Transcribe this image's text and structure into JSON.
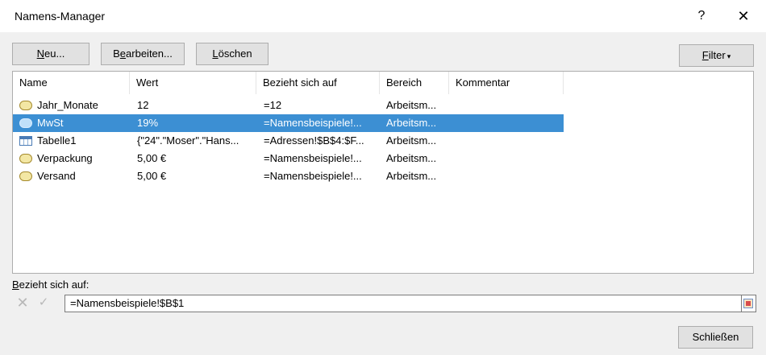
{
  "window": {
    "title": "Namens-Manager",
    "help_glyph": "?",
    "close_glyph": "✕"
  },
  "toolbar": {
    "new_label_u": "N",
    "new_label_rest": "eu...",
    "edit_label_pre": "B",
    "edit_label_u": "e",
    "edit_label_rest": "arbeiten...",
    "delete_label_u": "L",
    "delete_label_rest": "öschen",
    "filter_label_u": "F",
    "filter_label_rest": "ilter",
    "filter_arrow": "▾"
  },
  "list": {
    "columns": [
      "Name",
      "Wert",
      "Bezieht sich auf",
      "Bereich",
      "Kommentar"
    ],
    "rows": [
      {
        "icon": "name-icon",
        "name": "Jahr_Monate",
        "wert": "12",
        "bezug": "=12",
        "bereich": "Arbeitsm...",
        "kommentar": ""
      },
      {
        "icon": "name-icon",
        "name": "MwSt",
        "wert": "19%",
        "bezug": "=Namensbeispiele!...",
        "bereich": "Arbeitsm...",
        "kommentar": "",
        "selected": true
      },
      {
        "icon": "table-icon",
        "name": "Tabelle1",
        "wert": "{\"24\".\"Moser\".\"Hans...",
        "bezug": "=Adressen!$B$4:$F...",
        "bereich": "Arbeitsm...",
        "kommentar": ""
      },
      {
        "icon": "name-icon",
        "name": "Verpackung",
        "wert": "5,00 €",
        "bezug": "=Namensbeispiele!...",
        "bereich": "Arbeitsm...",
        "kommentar": ""
      },
      {
        "icon": "name-icon",
        "name": "Versand",
        "wert": "5,00 €",
        "bezug": "=Namensbeispiele!...",
        "bereich": "Arbeitsm...",
        "kommentar": ""
      }
    ]
  },
  "reference": {
    "label_u": "B",
    "label_rest": "ezieht sich auf:",
    "value": "=Namensbeispiele!$B$1",
    "cancel_glyph": "✕",
    "confirm_glyph": "✓"
  },
  "footer": {
    "close_label": "Schließen"
  },
  "colors": {
    "selection": "#3c8fd3",
    "dialog_bg": "#f0f0f0",
    "button_bg": "#e1e1e1"
  }
}
